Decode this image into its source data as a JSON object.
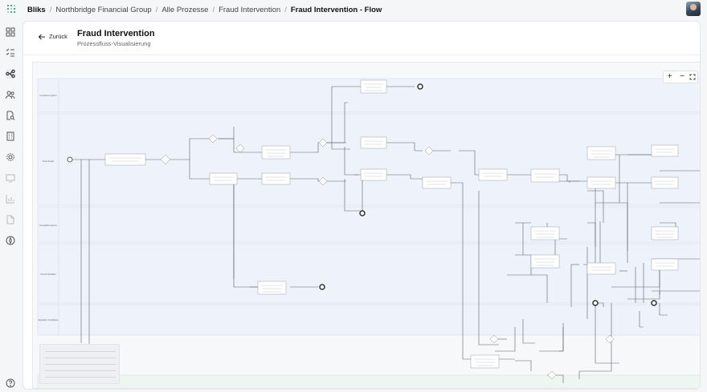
{
  "breadcrumb": {
    "items": [
      "Bliks",
      "Northbridge Financial Group",
      "Alle Prozesse",
      "Fraud Intervention",
      "Fraud Intervention - Flow"
    ]
  },
  "header": {
    "back_label": "Zurück",
    "title": "Fraud Intervention",
    "subtitle": "Prozessfluss-Visualisierung"
  },
  "zoom": {
    "in": "+",
    "out": "−"
  },
  "sidebar": {
    "icons": [
      "dashboard-icon",
      "list-check-icon",
      "flow-icon",
      "users-icon",
      "search-doc-icon",
      "building-icon",
      "settings-icon",
      "monitor-icon",
      "chart-icon",
      "document-icon",
      "compass-icon",
      "help-icon"
    ],
    "active": 2
  },
  "lanes": [
    {
      "label": "Compliance System"
    },
    {
      "label": "Fraud Analyst"
    },
    {
      "label": "Investigation Agency"
    },
    {
      "label": "Process Workflow"
    },
    {
      "label": "Regulatory Compliance"
    }
  ],
  "colors": {
    "lane_bg": "#eef3fb",
    "lane_border": "#dfe6f1",
    "edge": "#5c5f66",
    "node_border": "#9aa0a8"
  }
}
